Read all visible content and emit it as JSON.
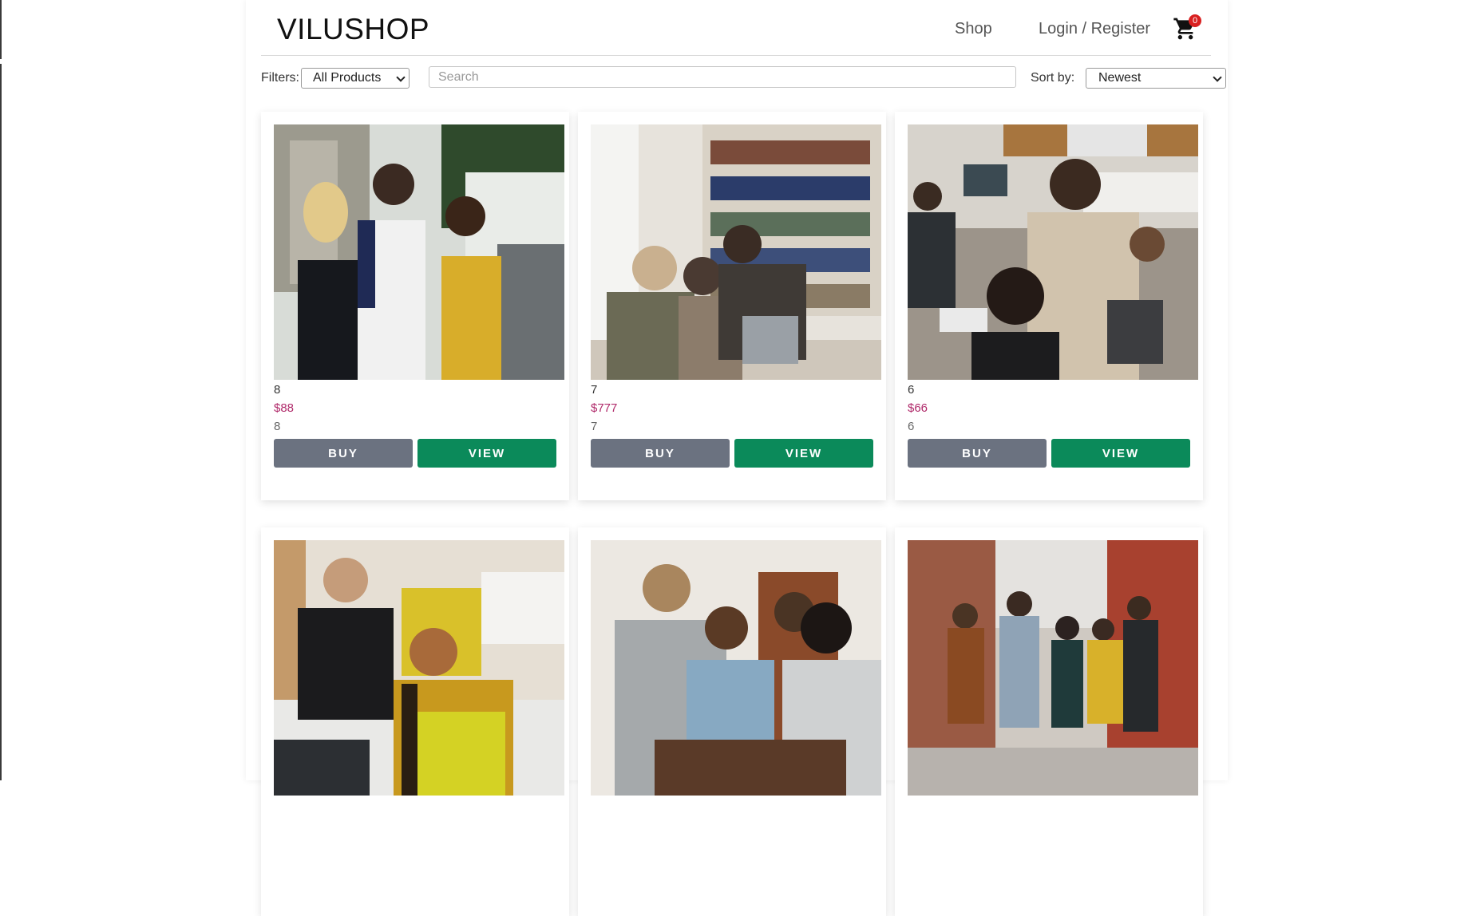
{
  "header": {
    "logo": "VILUSHOP",
    "nav_shop": "Shop",
    "nav_login": "Login / Register",
    "cart_count": "0"
  },
  "filters": {
    "label": "Filters:",
    "selected": "All Products",
    "search_placeholder": "Search",
    "sort_label": "Sort by:",
    "sort_selected": "Newest"
  },
  "colors": {
    "price": "#b02a6a",
    "buy_button": "#6b7280",
    "view_button": "#0b8a5a",
    "cart_badge": "#d92020"
  },
  "products": [
    {
      "title": "8",
      "price": "$88",
      "desc": "8",
      "buy_label": "BUY",
      "view_label": "VIEW",
      "image": "students-walking-outdoors"
    },
    {
      "title": "7",
      "price": "$777",
      "desc": "7",
      "buy_label": "BUY",
      "view_label": "VIEW",
      "image": "students-in-library"
    },
    {
      "title": "6",
      "price": "$66",
      "desc": "6",
      "buy_label": "BUY",
      "view_label": "VIEW",
      "image": "office-computer-lab"
    },
    {
      "title": "",
      "price": "",
      "desc": "",
      "buy_label": "",
      "view_label": "",
      "image": "coworkers-laughing-laptop"
    },
    {
      "title": "",
      "price": "",
      "desc": "",
      "buy_label": "",
      "view_label": "",
      "image": "friends-at-cafe-table"
    },
    {
      "title": "",
      "price": "",
      "desc": "",
      "buy_label": "",
      "view_label": "",
      "image": "group-walking-street"
    }
  ]
}
